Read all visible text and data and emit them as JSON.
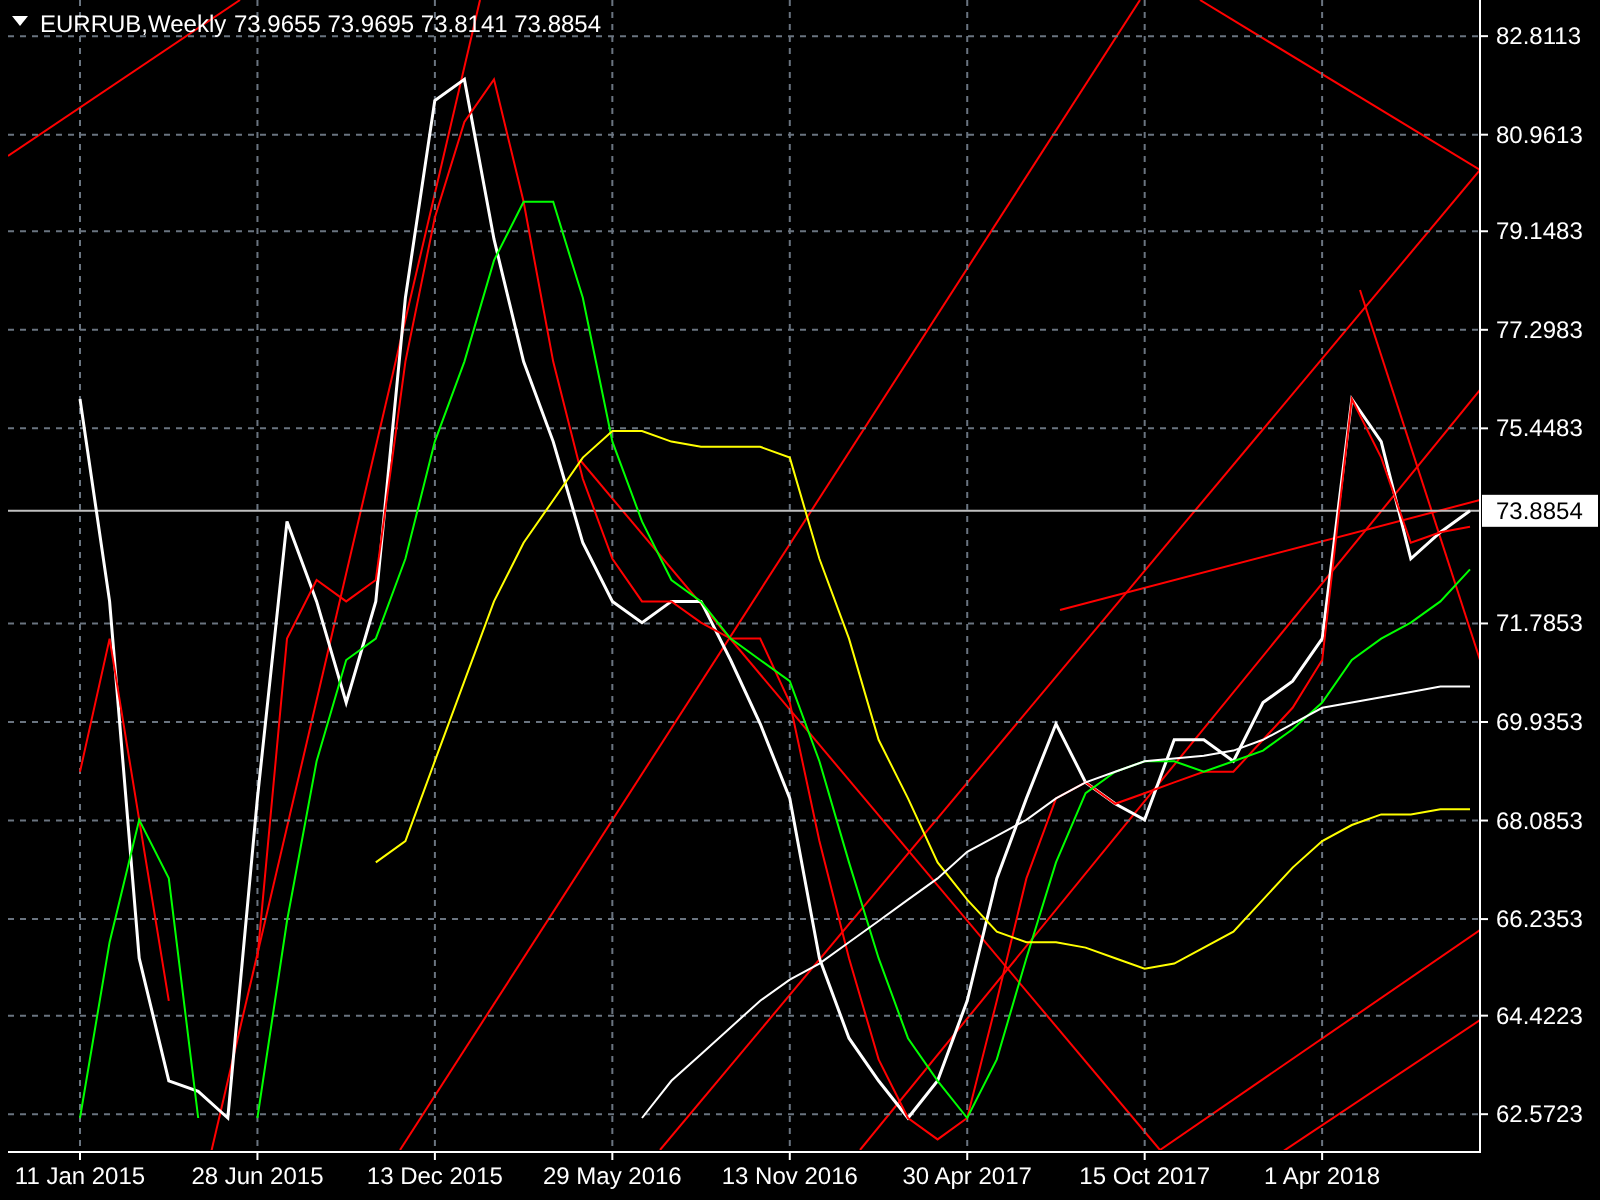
{
  "chart_header": {
    "symbol": "EURRUB,Weekly",
    "quote": "73.9655 73.9695 73.8141 73.8854"
  },
  "current_price_label": "73.8854",
  "chart_data": {
    "type": "line",
    "categories": [
      "11 Jan 2015",
      null,
      null,
      null,
      null,
      null,
      "28 Jun 2015",
      null,
      null,
      null,
      null,
      null,
      "13 Dec 2015",
      null,
      null,
      null,
      null,
      null,
      "29 May 2016",
      null,
      null,
      null,
      null,
      null,
      "13 Nov 2016",
      null,
      null,
      null,
      null,
      null,
      "30 Apr 2017",
      null,
      null,
      null,
      null,
      null,
      "15 Oct 2017",
      null,
      null,
      null,
      null,
      null,
      "1 Apr 2018",
      null,
      null,
      null,
      null,
      null
    ],
    "series": [
      {
        "color": "#ffffff",
        "values": [
          76,
          72.2,
          65.5,
          63.2,
          63,
          62.5,
          68.5,
          73.7,
          72.2,
          70.3,
          72.2,
          77.9,
          81.6,
          82,
          79,
          76.7,
          75.2,
          73.3,
          72.2,
          71.8,
          72.2,
          72.2,
          71.1,
          69.9,
          68.5,
          65.5,
          64,
          63.2,
          62.5,
          63.2,
          64.7,
          67,
          68.5,
          69.9,
          68.8,
          68.4,
          68.1,
          69.6,
          69.6,
          69.2,
          70.3,
          70.7,
          71.5,
          76,
          75.2,
          73,
          73.5,
          73.9
        ]
      },
      {
        "color": "#ff0000",
        "values": [
          69,
          71.5,
          68.1,
          64.7,
          null,
          null,
          65.5,
          71.5,
          72.6,
          72.2,
          72.6,
          76.7,
          79.4,
          81.2,
          82,
          79.7,
          76.7,
          74.5,
          73,
          72.2,
          72.2,
          71.8,
          71.5,
          71.5,
          70.3,
          67.7,
          65.5,
          63.6,
          62.5,
          62.1,
          62.5,
          64.7,
          67,
          68.5,
          68.8,
          68.4,
          68.6,
          68.8,
          69,
          69,
          69.6,
          70.2,
          71.1,
          76,
          74.9,
          73.3,
          73.5,
          73.6
        ]
      },
      {
        "color": "#00ff00",
        "values": [
          62.5,
          65.8,
          68.1,
          67,
          62.5,
          null,
          62.5,
          66.2,
          69.2,
          71.1,
          71.5,
          73,
          75.2,
          76.7,
          78.6,
          79.7,
          79.7,
          77.9,
          75.2,
          73.7,
          72.6,
          72.2,
          71.5,
          71.1,
          70.7,
          69.2,
          67.3,
          65.5,
          64,
          63.2,
          62.5,
          63.6,
          65.5,
          67.3,
          68.6,
          69,
          69.2,
          69.2,
          69,
          69.2,
          69.4,
          69.8,
          70.3,
          71.1,
          71.5,
          71.8,
          72.2,
          72.8
        ]
      },
      {
        "color": "#ffff00",
        "values": [
          null,
          null,
          null,
          null,
          null,
          null,
          null,
          null,
          null,
          null,
          67.3,
          67.7,
          69.2,
          70.7,
          72.2,
          73.3,
          74.1,
          74.9,
          75.4,
          75.4,
          75.2,
          75.1,
          75.1,
          75.1,
          74.9,
          73,
          71.5,
          69.6,
          68.5,
          67.3,
          66.6,
          66,
          65.8,
          65.8,
          65.7,
          65.5,
          65.3,
          65.4,
          65.7,
          66,
          66.6,
          67.2,
          67.7,
          68,
          68.2,
          68.2,
          68.3,
          68.3
        ]
      },
      {
        "color": "#ffffff",
        "values": [
          null,
          null,
          null,
          null,
          null,
          null,
          null,
          null,
          null,
          null,
          null,
          null,
          null,
          null,
          null,
          null,
          null,
          null,
          null,
          62.5,
          63.2,
          63.7,
          64.2,
          64.7,
          65.1,
          65.4,
          65.8,
          66.2,
          66.6,
          67,
          67.5,
          67.8,
          68.1,
          68.5,
          68.8,
          69,
          69.2,
          69.25,
          69.3,
          69.4,
          69.6,
          69.9,
          70.2,
          70.3,
          70.4,
          70.5,
          70.6,
          70.6
        ]
      }
    ],
    "ylim": [
      61.9,
      83.49
    ],
    "grid": true,
    "yticks": [
      {
        "value": 82.8113,
        "label": "82.8113"
      },
      {
        "value": 80.9613,
        "label": "80.9613"
      },
      {
        "value": 79.1483,
        "label": "79.1483"
      },
      {
        "value": 77.2983,
        "label": "77.2983"
      },
      {
        "value": 75.4483,
        "label": "75.4483"
      },
      {
        "value": 71.7853,
        "label": "71.7853"
      },
      {
        "value": 69.9353,
        "label": "69.9353"
      },
      {
        "value": 68.0853,
        "label": "68.0853"
      },
      {
        "value": 66.2353,
        "label": "66.2353"
      },
      {
        "value": 64.4223,
        "label": "64.4223"
      },
      {
        "value": 62.5723,
        "label": "62.5723"
      }
    ]
  }
}
